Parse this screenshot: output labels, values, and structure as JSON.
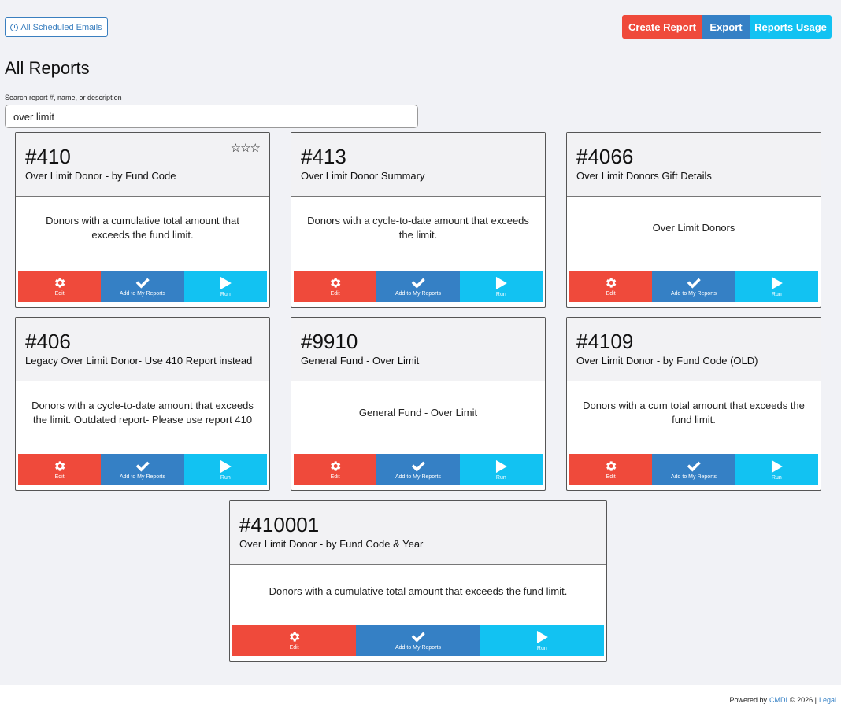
{
  "header": {
    "scheduled_label": "All Scheduled Emails",
    "create_label": "Create Report",
    "export_label": "Export",
    "usage_label": "Reports Usage"
  },
  "page_title": "All Reports",
  "search": {
    "label": "Search report #, name, or description",
    "value": "over limit"
  },
  "actions": {
    "edit": "Edit",
    "add": "Add to My Reports",
    "run": "Run"
  },
  "reports": [
    {
      "number": "#410",
      "name": "Over Limit Donor - by Fund Code",
      "description": "Donors with a cumulative total amount that exceeds the fund limit.",
      "stars": "☆☆☆"
    },
    {
      "number": "#413",
      "name": "Over Limit Donor Summary",
      "description": "Donors with a cycle-to-date amount that exceeds the limit."
    },
    {
      "number": "#4066",
      "name": "Over Limit Donors Gift Details",
      "description": "Over Limit Donors"
    },
    {
      "number": "#406",
      "name": "Legacy Over Limit Donor- Use 410 Report instead",
      "description": "Donors with a cycle-to-date amount that exceeds the limit. Outdated report- Please use report 410"
    },
    {
      "number": "#9910",
      "name": "General Fund - Over Limit",
      "description": "General Fund - Over Limit"
    },
    {
      "number": "#4109",
      "name": "Over Limit Donor - by Fund Code (OLD)",
      "description": "Donors with a cum total amount that exceeds the fund limit."
    },
    {
      "number": "#410001",
      "name": "Over Limit Donor - by Fund Code & Year",
      "description": "Donors with a cumulative total amount that exceeds the fund limit."
    }
  ],
  "footer": {
    "powered_by": "Powered by",
    "company": "CMDI",
    "copyright": "© 2026 |",
    "legal": "Legal"
  },
  "colors": {
    "edit": "#ef4a3b",
    "add": "#3580c5",
    "run": "#12c2f2",
    "background": "#f1f2f6"
  }
}
